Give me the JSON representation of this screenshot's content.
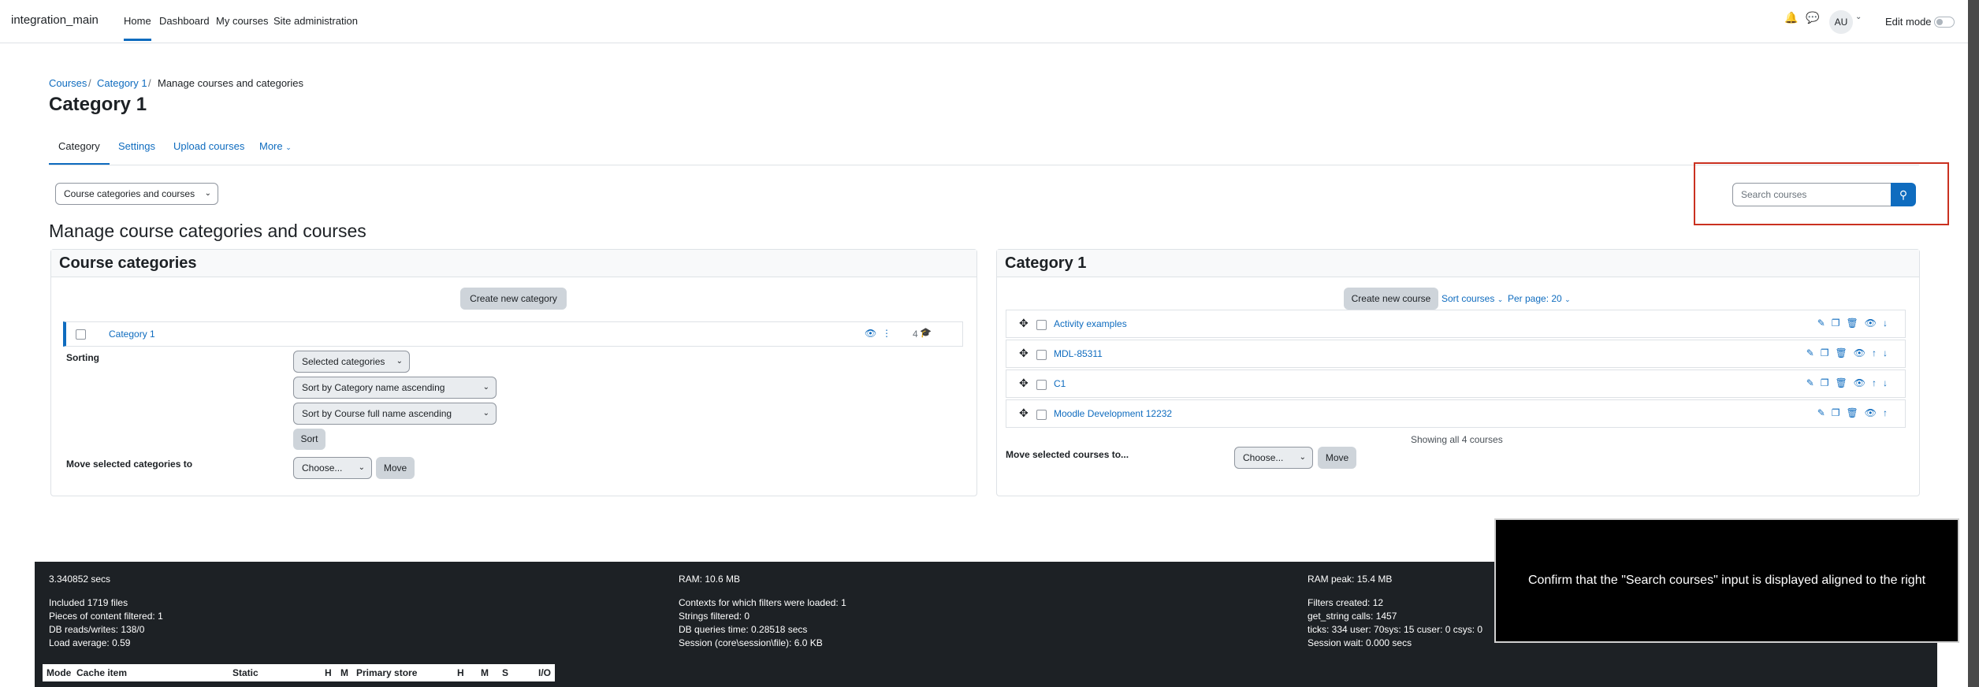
{
  "navbar": {
    "brand": "integration_main",
    "links": [
      "Home",
      "Dashboard",
      "My courses",
      "Site administration"
    ],
    "avatar": "AU",
    "edit_mode": "Edit mode"
  },
  "breadcrumb": [
    "Courses",
    "Category 1",
    "Manage courses and categories"
  ],
  "page_title": "Category 1",
  "tabs": [
    "Category",
    "Settings",
    "Upload courses",
    "More"
  ],
  "view_select": "Course categories and courses",
  "search": {
    "placeholder": "Search courses"
  },
  "manage_heading": "Manage course categories and courses",
  "categories_panel": {
    "title": "Course categories",
    "create_button": "Create new category",
    "category_name": "Category 1",
    "course_count": "4",
    "sorting_label": "Sorting",
    "sort_select_1": "Selected categories",
    "sort_select_2": "Sort by Category name ascending",
    "sort_select_3": "Sort by Course full name ascending",
    "sort_button": "Sort",
    "move_label": "Move selected categories to",
    "move_select": "Choose...",
    "move_button": "Move"
  },
  "courses_panel": {
    "title": "Category 1",
    "create_button": "Create new course",
    "sort_courses": "Sort courses",
    "per_page": "Per page: 20",
    "courses": [
      "Activity examples",
      "MDL-85311",
      "C1",
      "Moodle Development 12232"
    ],
    "showing": "Showing all 4 courses",
    "move_label": "Move selected courses to...",
    "move_select": "Choose...",
    "move_button": "Move"
  },
  "footer": {
    "col1": [
      "3.340852 secs",
      "Included 1719 files",
      "Pieces of content filtered: 1",
      "DB reads/writes: 138/0",
      "Load average: 0.59"
    ],
    "col2": [
      "RAM: 10.6 MB",
      "Contexts for which filters were loaded: 1",
      "Strings filtered: 0",
      "DB queries time: 0.28518 secs",
      "Session (core\\session\\file): 6.0 KB"
    ],
    "col3": [
      "RAM peak: 15.4 MB",
      "Filters created: 12",
      "get_string calls: 1457",
      "ticks: 334 user: 70sys: 15 cuser: 0 csys: 0",
      "Session wait: 0.000 secs"
    ],
    "table_headers": [
      "Mode",
      "Cache item",
      "Static",
      "H",
      "M",
      "Primary store",
      "H",
      "M",
      "S",
      "I/O"
    ]
  },
  "overlay": {
    "text": "Confirm that the \"Search courses\" input is displayed aligned to the right"
  }
}
